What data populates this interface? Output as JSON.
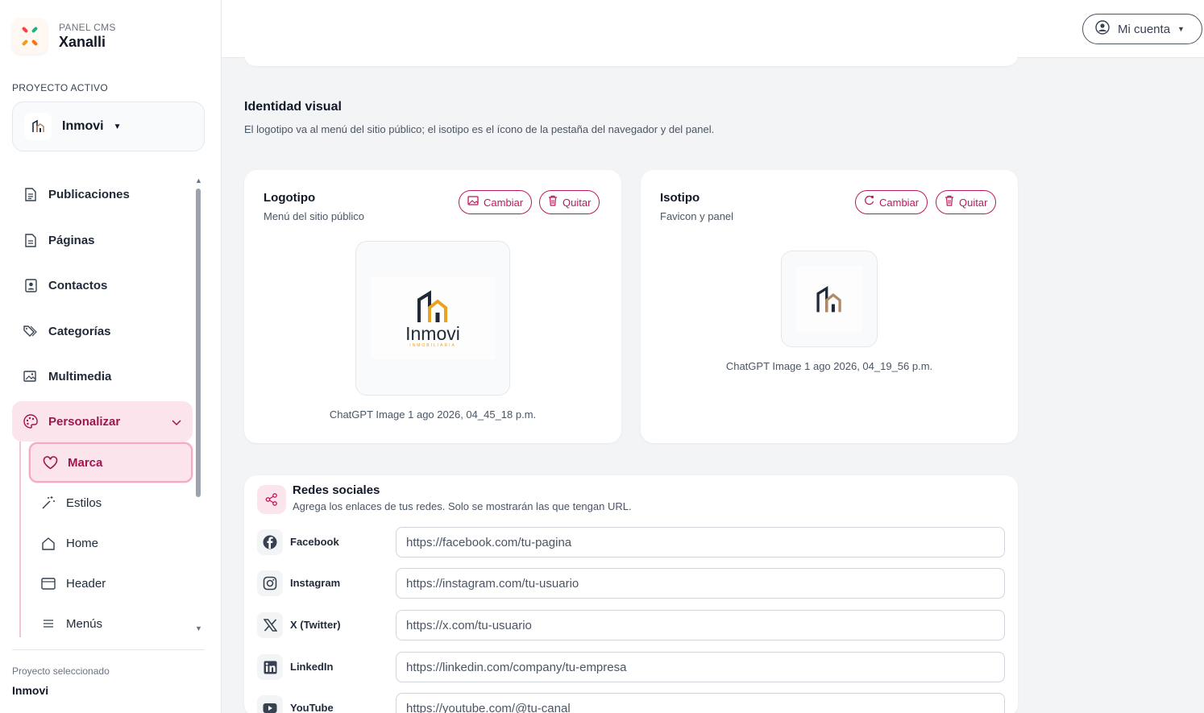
{
  "brand": {
    "kicker": "PANEL CMS",
    "name": "Xanalli"
  },
  "project": {
    "label": "PROYECTO ACTIVO",
    "name": "Inmovi"
  },
  "nav": {
    "items": [
      {
        "label": "Publicaciones",
        "icon": "document-icon"
      },
      {
        "label": "Páginas",
        "icon": "page-icon"
      },
      {
        "label": "Contactos",
        "icon": "contact-icon"
      },
      {
        "label": "Categorías",
        "icon": "tags-icon"
      },
      {
        "label": "Multimedia",
        "icon": "images-icon"
      },
      {
        "label": "Personalizar",
        "icon": "palette-icon"
      }
    ],
    "sub": [
      {
        "label": "Marca",
        "icon": "heart-icon"
      },
      {
        "label": "Estilos",
        "icon": "magic-wand-icon"
      },
      {
        "label": "Home",
        "icon": "house-icon"
      },
      {
        "label": "Header",
        "icon": "window-icon"
      },
      {
        "label": "Menús",
        "icon": "list-icon"
      }
    ]
  },
  "footer": {
    "label": "Proyecto seleccionado",
    "name": "Inmovi"
  },
  "topbar": {
    "account": "Mi cuenta"
  },
  "identity": {
    "title": "Identidad visual",
    "desc": "El logotipo va al menú del sitio público; el isotipo es el ícono de la pestaña del navegador y del panel.",
    "logo": {
      "title": "Logotipo",
      "subtitle": "Menú del sitio público",
      "change": "Cambiar",
      "remove": "Quitar",
      "brand_word": "Inmovi",
      "brand_tag": "INMOBILIARIA",
      "caption": "ChatGPT Image 1 ago 2026, 04_45_18 p.m."
    },
    "iso": {
      "title": "Isotipo",
      "subtitle": "Favicon y panel",
      "change": "Cambiar",
      "remove": "Quitar",
      "caption": "ChatGPT Image 1 ago 2026, 04_19_56 p.m."
    }
  },
  "social": {
    "title": "Redes sociales",
    "desc": "Agrega los enlaces de tus redes. Solo se mostrarán las que tengan URL.",
    "rows": [
      {
        "name": "Facebook",
        "placeholder": "https://facebook.com/tu-pagina",
        "icon": "facebook-icon"
      },
      {
        "name": "Instagram",
        "placeholder": "https://instagram.com/tu-usuario",
        "icon": "instagram-icon"
      },
      {
        "name": "X (Twitter)",
        "placeholder": "https://x.com/tu-usuario",
        "icon": "x-twitter-icon"
      },
      {
        "name": "LinkedIn",
        "placeholder": "https://linkedin.com/company/tu-empresa",
        "icon": "linkedin-icon"
      },
      {
        "name": "YouTube",
        "placeholder": "https://youtube.com/@tu-canal",
        "icon": "youtube-icon"
      }
    ]
  },
  "colors": {
    "accent": "#be185d",
    "accent_bg": "#fbe4ec",
    "logo_gold": "#e8a321",
    "logo_dark": "#1f2937"
  }
}
